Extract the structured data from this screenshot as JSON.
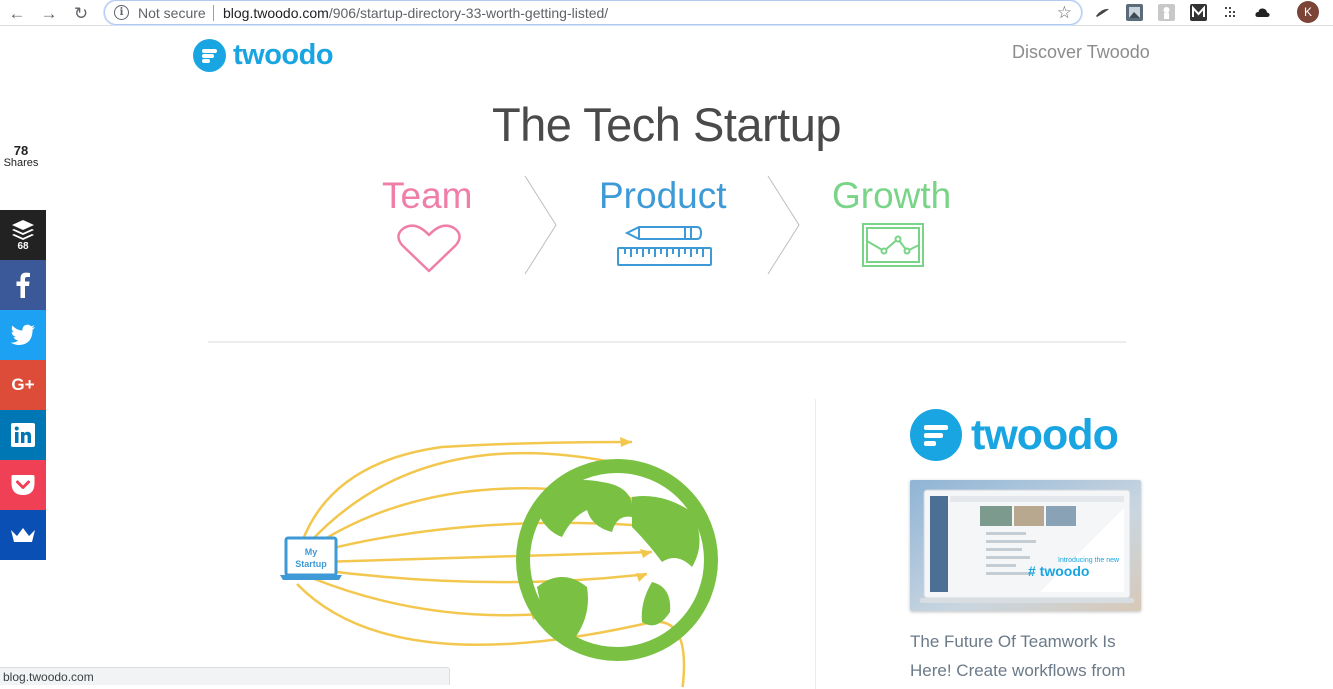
{
  "browser": {
    "security_label": "Not secure",
    "url_host": "blog.twoodo.com",
    "url_path": "/906/startup-directory-33-worth-getting-listed/",
    "profile_initial": "K",
    "status_url": "blog.twoodo.com"
  },
  "site": {
    "logo_text": "twoodo",
    "nav_link": "Discover Twoodo",
    "brand_color": "#19a5e1"
  },
  "hero": {
    "title": "The Tech Startup",
    "steps": [
      {
        "label": "Team",
        "icon": "heart-icon",
        "color": "#ef7fa8"
      },
      {
        "label": "Product",
        "icon": "pencil-ruler-icon",
        "color": "#3d9ad6"
      },
      {
        "label": "Growth",
        "icon": "growth-chart-icon",
        "color": "#79d487"
      }
    ]
  },
  "share": {
    "count": "78",
    "count_label": "Shares",
    "buttons": [
      {
        "name": "buffer",
        "icon": "buffer-icon",
        "count": "68",
        "color": "#222222"
      },
      {
        "name": "facebook",
        "icon": "facebook-icon",
        "color": "#3b5998"
      },
      {
        "name": "twitter",
        "icon": "twitter-icon",
        "color": "#1da1f2"
      },
      {
        "name": "google-plus",
        "icon": "google-plus-icon",
        "color": "#dd4b39"
      },
      {
        "name": "linkedin",
        "icon": "linkedin-icon",
        "color": "#0077b5"
      },
      {
        "name": "pocket",
        "icon": "pocket-icon",
        "color": "#ef4056"
      },
      {
        "name": "sumome",
        "icon": "crown-icon",
        "color": "#0a4fb4"
      }
    ]
  },
  "illustration": {
    "laptop_label_line1": "My",
    "laptop_label_line2": "Startup"
  },
  "sidebar_ad": {
    "logo_text": "twoodo",
    "screenshot_caption_line1": "Introducing the new",
    "screenshot_caption_line2": "# twoodo",
    "caption": "The Future Of Teamwork Is Here! Create workflows from"
  }
}
